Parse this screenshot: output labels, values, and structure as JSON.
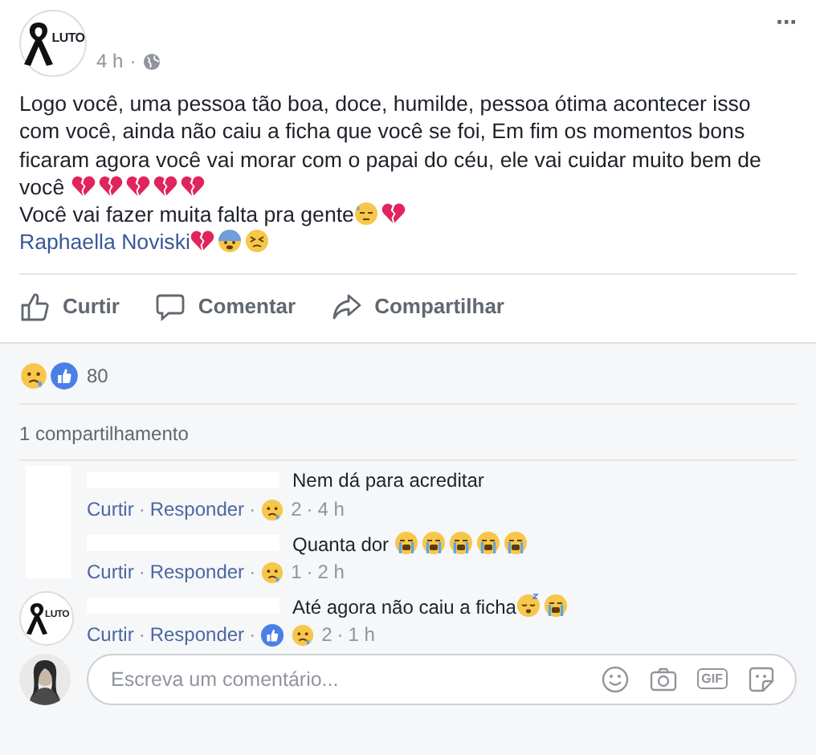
{
  "post": {
    "avatar": {
      "label": "LUTO"
    },
    "time": "4 h",
    "separator": "·",
    "menu": "···",
    "lines": [
      {
        "text": "Logo você, uma pessoa tão boa, doce, humilde, pessoa ótima acontecer isso com você, ainda não caiu a ficha que você se foi, Em fim os momentos bons ficaram agora você vai morar com o papai do céu, ele vai cuidar muito bem de você ",
        "emojis": [
          {
            "kind": "broken_heart"
          },
          {
            "kind": "broken_heart"
          },
          {
            "kind": "broken_heart"
          },
          {
            "kind": "broken_heart"
          },
          {
            "kind": "broken_heart"
          }
        ],
        "kind": "plain"
      },
      {
        "text": "Você vai fazer muita falta pra gente",
        "emojis": [
          {
            "kind": "downcast_sweat"
          },
          {
            "kind": "broken_heart"
          }
        ],
        "kind": "plain"
      },
      {
        "text": "Raphaella Noviski",
        "emojis": [
          {
            "kind": "broken_heart"
          },
          {
            "kind": "cold_sweat"
          },
          {
            "kind": "persevere"
          }
        ],
        "kind": "mention"
      }
    ]
  },
  "actions": [
    {
      "kind": "like",
      "label": "Curtir"
    },
    {
      "kind": "comment",
      "label": "Comentar"
    },
    {
      "kind": "share",
      "label": "Compartilhar"
    }
  ],
  "reactions": {
    "icons": [
      {
        "kind": "sad"
      },
      {
        "kind": "like"
      }
    ],
    "count": "80"
  },
  "shares": "1 compartilhamento",
  "comments": [
    {
      "avatar": {
        "kind": "blank"
      },
      "text": "Nem dá para acreditar",
      "like": "Curtir",
      "reply": "Responder",
      "reaction_icons": [
        {
          "kind": "sad"
        }
      ],
      "reaction_count": "2",
      "time": "4 h",
      "separators": [
        "·",
        "·",
        "·"
      ]
    },
    {
      "avatar": {
        "kind": "none"
      },
      "text": "Quanta dor ",
      "emojis": [
        {
          "kind": "cry"
        },
        {
          "kind": "cry"
        },
        {
          "kind": "cry"
        },
        {
          "kind": "cry"
        },
        {
          "kind": "cry"
        }
      ],
      "like": "Curtir",
      "reply": "Responder",
      "reaction_icons": [
        {
          "kind": "sad"
        }
      ],
      "reaction_count": "1",
      "time": "2 h",
      "separators": [
        "·",
        "·",
        "·"
      ]
    },
    {
      "avatar": {
        "kind": "logo",
        "label": "LUTO"
      },
      "text": "Até agora não caiu a ficha",
      "emojis": [
        {
          "kind": "sleeping"
        },
        {
          "kind": "cry"
        }
      ],
      "like": "Curtir",
      "reply": "Responder",
      "reaction_icons": [
        {
          "kind": "like"
        },
        {
          "kind": "sad"
        }
      ],
      "reaction_count": "2",
      "time": "1 h",
      "separators": [
        "·",
        "·",
        "·"
      ]
    }
  ],
  "composer": {
    "placeholder": "Escreva um comentário...",
    "gif_label": "GIF"
  }
}
